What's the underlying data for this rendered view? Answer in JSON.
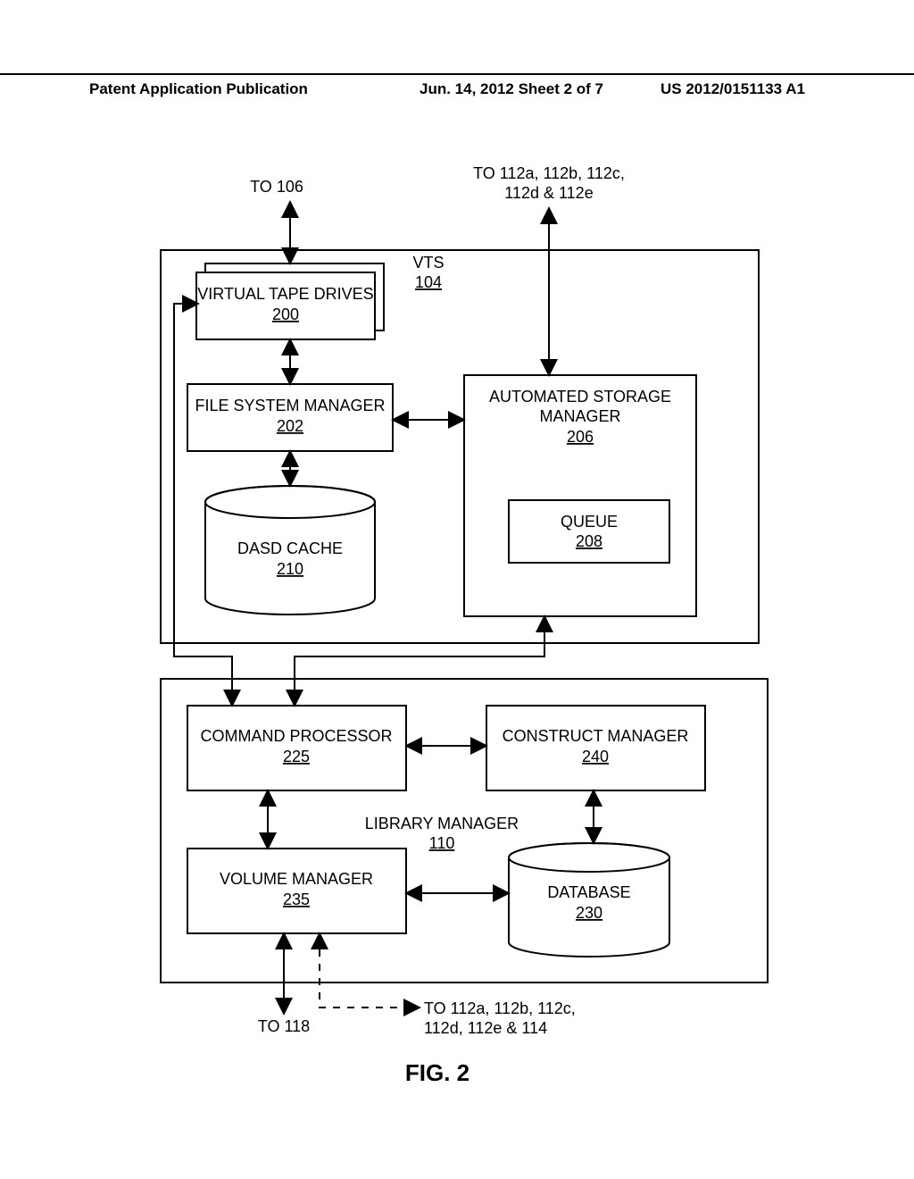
{
  "header": {
    "left": "Patent Application Publication",
    "center": "Jun. 14, 2012  Sheet 2 of 7",
    "right": "US 2012/0151133 A1"
  },
  "ext_labels": {
    "to106": "TO 106",
    "to112_top_a": "TO 112a, 112b, 112c,",
    "to112_top_b": "112d & 112e",
    "to118": "TO 118",
    "to112_bot_a": "TO 112a, 112b, 112c,",
    "to112_bot_b": "112d, 112e & 114"
  },
  "vts": {
    "title": "VTS",
    "ref": "104"
  },
  "vtd": {
    "title": "VIRTUAL TAPE DRIVES",
    "ref": "200"
  },
  "fsm": {
    "title": "FILE SYSTEM MANAGER",
    "ref": "202"
  },
  "asm": {
    "title": "AUTOMATED STORAGE",
    "title2": "MANAGER",
    "ref": "206"
  },
  "queue": {
    "title": "QUEUE",
    "ref": "208"
  },
  "dasd": {
    "title": "DASD CACHE",
    "ref": "210"
  },
  "lm": {
    "title": "LIBRARY MANAGER",
    "ref": "110"
  },
  "cp": {
    "title": "COMMAND PROCESSOR",
    "ref": "225"
  },
  "cm": {
    "title": "CONSTRUCT MANAGER",
    "ref": "240"
  },
  "vm": {
    "title": "VOLUME MANAGER",
    "ref": "235"
  },
  "db": {
    "title": "DATABASE",
    "ref": "230"
  },
  "figcap": "FIG. 2"
}
